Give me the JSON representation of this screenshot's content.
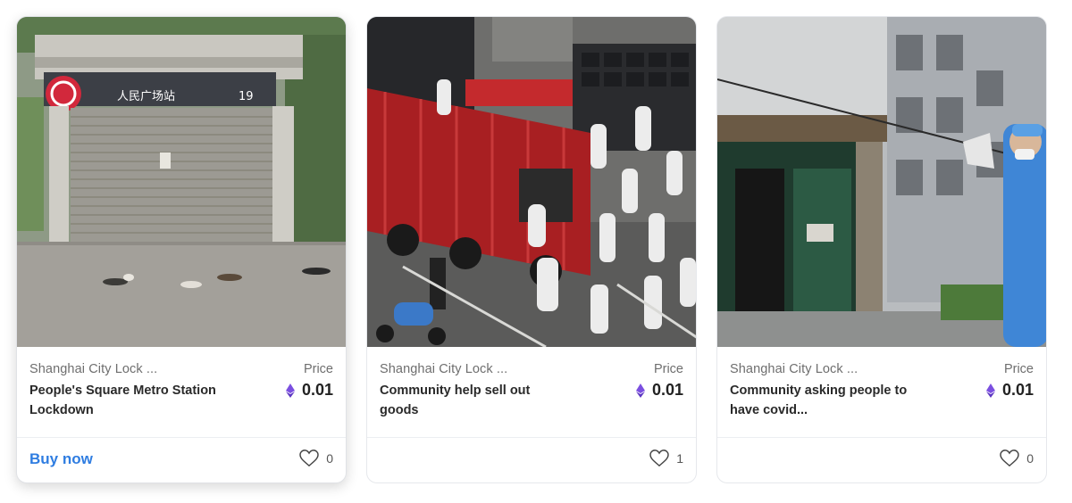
{
  "cards": [
    {
      "collection": "Shanghai City Lock ...",
      "title": "People's Square Metro Station Lockdown",
      "price_label": "Price",
      "price": "0.01",
      "buy_label": "Buy now",
      "likes": "0",
      "sign_text": "人民广场站",
      "sign_number": "19"
    },
    {
      "collection": "Shanghai City Lock ...",
      "title": "Community help sell out goods",
      "price_label": "Price",
      "price": "0.01",
      "likes": "1"
    },
    {
      "collection": "Shanghai City Lock ...",
      "title": "Community asking people to have covid...",
      "price_label": "Price",
      "price": "0.01",
      "likes": "0"
    }
  ],
  "icons": {
    "currency": "ethereum-icon",
    "like": "heart-icon"
  },
  "colors": {
    "accent_link": "#2f7de1",
    "ethereum": "#7b4fe0",
    "metro_logo": "#d2283c"
  }
}
